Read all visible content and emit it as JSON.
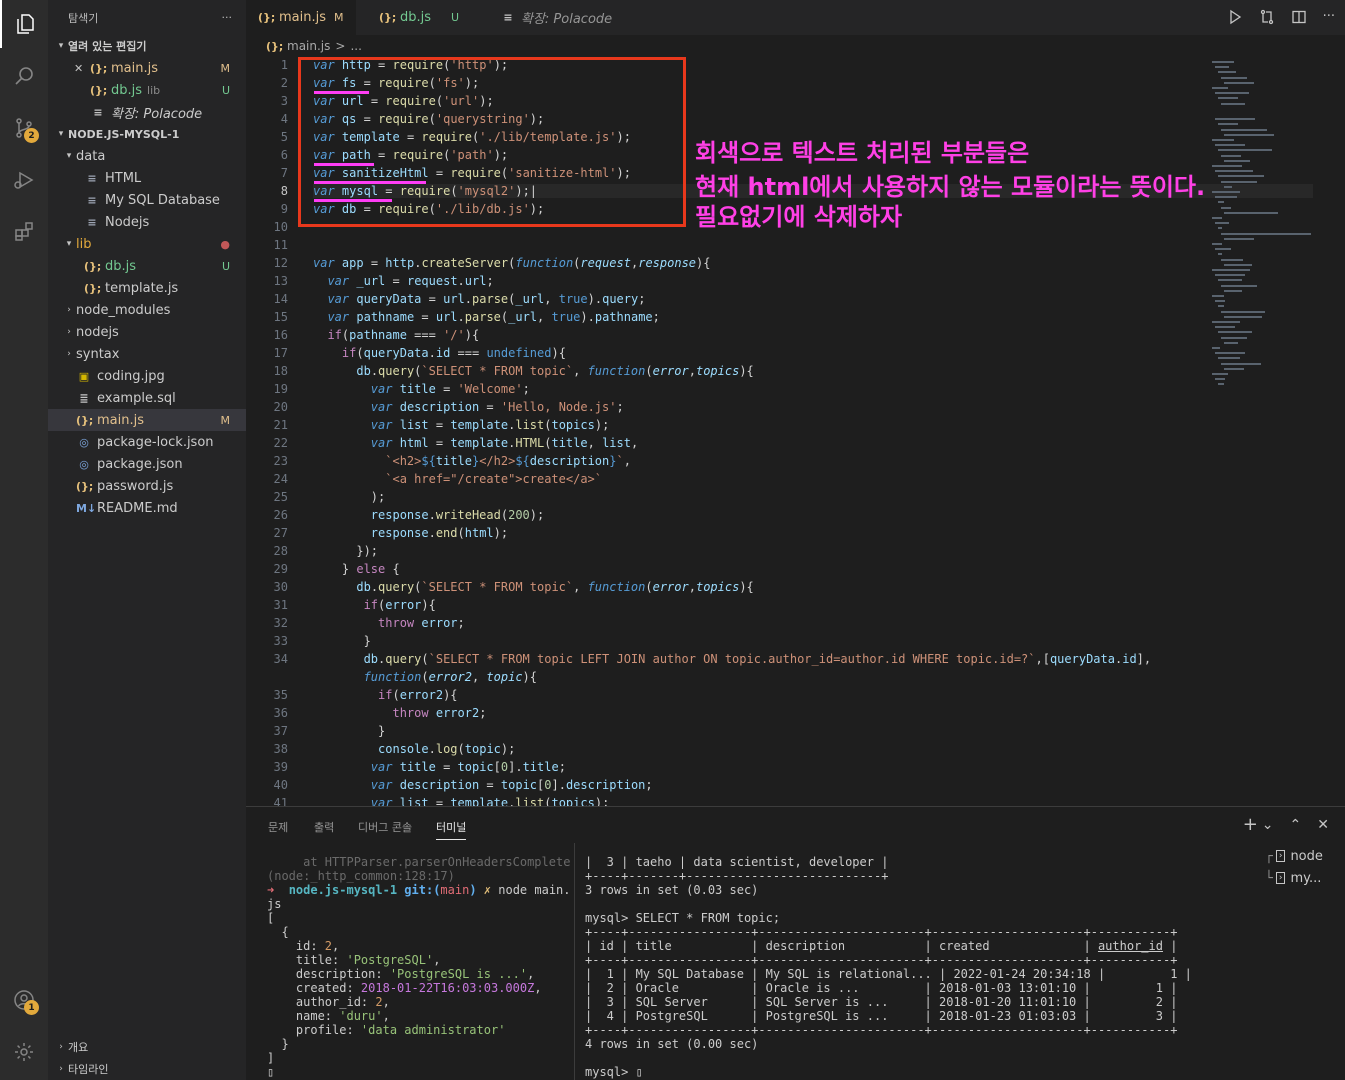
{
  "activity_bar": {
    "scm_badge": "2",
    "account_badge": "1"
  },
  "explorer": {
    "title": "탐색기",
    "more": "···",
    "open_editors_title": "열려 있는 편집기",
    "open_editors": [
      {
        "close": "✕",
        "icon": "(};",
        "name": "main.js",
        "suffix": "",
        "deco": "M"
      },
      {
        "icon": "(};",
        "name": "db.js",
        "suffix": "lib",
        "deco": "U"
      },
      {
        "icon": "≡",
        "name": "확장: Polacode",
        "suffix": "",
        "deco": ""
      }
    ],
    "project_title": "NODE.JS-MYSQL-1",
    "tree": [
      {
        "chev": "▾",
        "icon": "",
        "name": "data",
        "deco": ""
      },
      {
        "chev": "",
        "icon": "≡",
        "name": "HTML",
        "deco": ""
      },
      {
        "chev": "",
        "icon": "≡",
        "name": "My SQL Database",
        "deco": ""
      },
      {
        "chev": "",
        "icon": "≡",
        "name": "Nodejs",
        "deco": ""
      },
      {
        "chev": "▾",
        "icon": "",
        "name": "lib",
        "deco": "●"
      },
      {
        "chev": "",
        "icon": "(};",
        "name": "db.js",
        "deco": "U"
      },
      {
        "chev": "",
        "icon": "(};",
        "name": "template.js",
        "deco": ""
      },
      {
        "chev": "›",
        "icon": "",
        "name": "node_modules",
        "deco": ""
      },
      {
        "chev": "›",
        "icon": "",
        "name": "nodejs",
        "deco": ""
      },
      {
        "chev": "›",
        "icon": "",
        "name": "syntax",
        "deco": ""
      },
      {
        "chev": "",
        "icon": "▣",
        "name": "coding.jpg",
        "deco": ""
      },
      {
        "chev": "",
        "icon": "≣",
        "name": "example.sql",
        "deco": ""
      },
      {
        "chev": "",
        "icon": "(};",
        "name": "main.js",
        "deco": "M"
      },
      {
        "chev": "",
        "icon": "◎",
        "name": "package-lock.json",
        "deco": ""
      },
      {
        "chev": "",
        "icon": "◎",
        "name": "package.json",
        "deco": ""
      },
      {
        "chev": "",
        "icon": "(};",
        "name": "password.js",
        "deco": ""
      },
      {
        "chev": "",
        "icon": "M↓",
        "name": "README.md",
        "deco": ""
      }
    ],
    "outline_title": "개요",
    "timeline_title": "타임라인"
  },
  "tabs": [
    {
      "icon": "(};",
      "name": "main.js",
      "deco": "M"
    },
    {
      "icon": "(};",
      "name": "db.js",
      "deco": "U"
    },
    {
      "icon": "≡",
      "name": "확장: Polacode",
      "deco": ""
    }
  ],
  "breadcrumb": {
    "icon": "(};",
    "file": "main.js",
    "sep": ">",
    "more": "..."
  },
  "code": {
    "line_numbers": [
      "1",
      "2",
      "3",
      "4",
      "5",
      "6",
      "7",
      "8",
      "9",
      "10",
      "11",
      "12",
      "13",
      "14",
      "15",
      "16",
      "17",
      "18",
      "19",
      "20",
      "21",
      "22",
      "23",
      "24",
      "25",
      "26",
      "27",
      "28",
      "29",
      "30",
      "31",
      "32",
      "33",
      "34",
      "",
      "35",
      "36",
      "37",
      "38",
      "39",
      "40",
      "41"
    ],
    "current_line": "8"
  },
  "annotation": {
    "lines": [
      "회색으로 텍스트 처리된 부분들은",
      "현재 html에서 사용하지 않는 모듈이라는 뜻이다.",
      "필요없기에 삭제하자"
    ]
  },
  "panel": {
    "tabs": [
      "문제",
      "출력",
      "디버그 콘솔",
      "터미널"
    ],
    "active_tab": "터미널",
    "plus": "+",
    "chevron": "⌄",
    "maximize": "⌃",
    "close": "✕",
    "terminals": [
      "node",
      "my..."
    ]
  }
}
